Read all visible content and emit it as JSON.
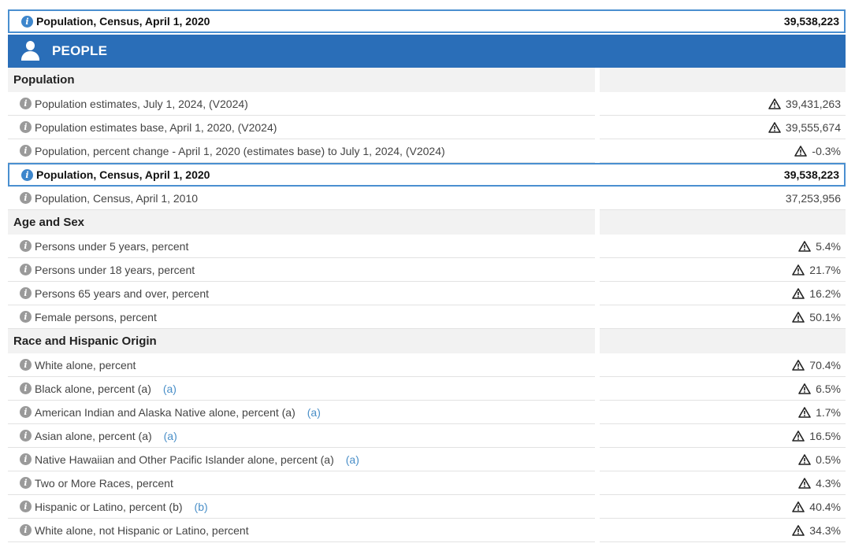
{
  "top_highlight": {
    "label": "Population, Census, April 1, 2020",
    "value": "39,538,223"
  },
  "people_header": {
    "title": "PEOPLE",
    "icon": "person-icon"
  },
  "sections": [
    {
      "title": "Population",
      "rows": [
        {
          "label": "Population estimates, July 1, 2024, (V2024)",
          "value": "39,431,263",
          "warning": true
        },
        {
          "label": "Population estimates base, April 1, 2020, (V2024)",
          "value": "39,555,674",
          "warning": true
        },
        {
          "label": "Population, percent change - April 1, 2020 (estimates base) to July 1, 2024, (V2024)",
          "value": "-0.3%",
          "warning": true
        },
        {
          "label": "Population, Census, April 1, 2020",
          "value": "39,538,223",
          "highlight": true
        },
        {
          "label": "Population, Census, April 1, 2010",
          "value": "37,253,956"
        }
      ]
    },
    {
      "title": "Age and Sex",
      "rows": [
        {
          "label": "Persons under 5 years, percent",
          "value": "5.4%",
          "warning": true
        },
        {
          "label": "Persons under 18 years, percent",
          "value": "21.7%",
          "warning": true
        },
        {
          "label": "Persons 65 years and over, percent",
          "value": "16.2%",
          "warning": true
        },
        {
          "label": "Female persons, percent",
          "value": "50.1%",
          "warning": true
        }
      ]
    },
    {
      "title": "Race and Hispanic Origin",
      "rows": [
        {
          "label": "White alone, percent",
          "value": "70.4%",
          "warning": true
        },
        {
          "label": "Black alone, percent (a)",
          "footnote": "(a)",
          "value": "6.5%",
          "warning": true
        },
        {
          "label": "American Indian and Alaska Native alone, percent (a)",
          "footnote": "(a)",
          "value": "1.7%",
          "warning": true
        },
        {
          "label": "Asian alone, percent (a)",
          "footnote": "(a)",
          "value": "16.5%",
          "warning": true
        },
        {
          "label": "Native Hawaiian and Other Pacific Islander alone, percent (a)",
          "footnote": "(a)",
          "value": "0.5%",
          "warning": true
        },
        {
          "label": "Two or More Races, percent",
          "value": "4.3%",
          "warning": true
        },
        {
          "label": "Hispanic or Latino, percent (b)",
          "footnote": "(b)",
          "value": "40.4%",
          "warning": true
        },
        {
          "label": "White alone, not Hispanic or Latino, percent",
          "value": "34.3%",
          "warning": true
        }
      ]
    }
  ],
  "icons": {
    "info": "info-icon",
    "warning": "warning-triangle-icon"
  },
  "colors": {
    "header_blue": "#2a6eb8",
    "highlight_border": "#4a8fd0",
    "footnote_blue": "#4a8fc8"
  }
}
